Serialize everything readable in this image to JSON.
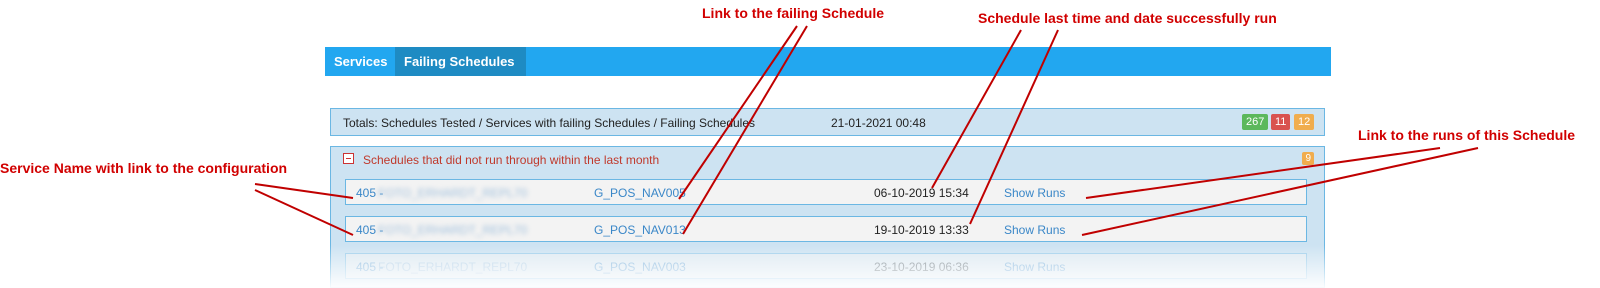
{
  "annotations": {
    "link_failing_schedule": "Link to the failing Schedule",
    "schedule_last_run": "Schedule last time and date successfully run",
    "link_runs": "Link to the runs of this Schedule",
    "service_name": "Service Name with link to the configuration"
  },
  "nav": {
    "tabs": [
      {
        "label": "Services"
      },
      {
        "label": "Failing Schedules"
      }
    ]
  },
  "totals": {
    "label": "Totals: Schedules Tested / Services with failing Schedules / Failing Schedules",
    "date": "21-01-2021 00:48",
    "badges": [
      "267",
      "11",
      "12"
    ],
    "colors": {
      "green": "#5cb85c",
      "red": "#d9534f",
      "orange": "#f0ad4e"
    }
  },
  "section": {
    "title": "Schedules that did not run through within the last month",
    "count": "9",
    "rows": [
      {
        "service_id": "405 -",
        "service_name": "FOTO_ERHARDT_REPL70",
        "schedule": "G_POS_NAV005",
        "last_run": "06-10-2019 15:34",
        "runs_label": "Show Runs"
      },
      {
        "service_id": "405 -",
        "service_name": "FOTO_ERHARDT_REPL70",
        "schedule": "G_POS_NAV013",
        "last_run": "19-10-2019 13:33",
        "runs_label": "Show Runs"
      },
      {
        "service_id": "405 -",
        "service_name": "FOTO_ERHARDT_REPL70",
        "schedule": "G_POS_NAV003",
        "last_run": "23-10-2019 06:36",
        "runs_label": "Show Runs"
      }
    ]
  },
  "theme": {
    "nav_blue": "#22a7f0",
    "annotation_red": "#d10000"
  }
}
